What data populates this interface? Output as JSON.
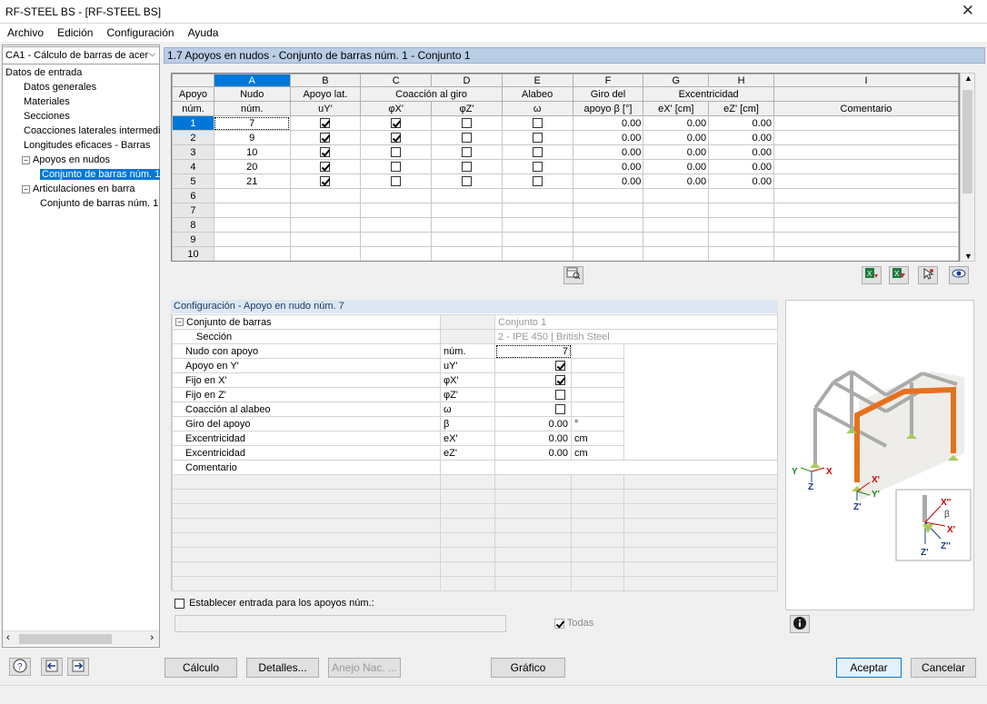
{
  "window": {
    "title": "RF-STEEL BS - [RF-STEEL BS]"
  },
  "menu": [
    "Archivo",
    "Edición",
    "Configuración",
    "Ayuda"
  ],
  "case_select": "CA1 - Cálculo de barras de acer",
  "tree": [
    {
      "label": "Datos de entrada",
      "level": 0
    },
    {
      "label": "Datos generales",
      "level": 1
    },
    {
      "label": "Materiales",
      "level": 1
    },
    {
      "label": "Secciones",
      "level": 1
    },
    {
      "label": "Coacciones laterales intermedia",
      "level": 1
    },
    {
      "label": "Longitudes eficaces - Barras",
      "level": 1
    },
    {
      "label": "Apoyos en nudos",
      "level": 1,
      "expander": "−"
    },
    {
      "label": "Conjunto de barras núm. 1",
      "level": 2,
      "selected": true
    },
    {
      "label": "Articulaciones en barra",
      "level": 1,
      "expander": "−"
    },
    {
      "label": "Conjunto de barras núm. 1",
      "level": 2
    }
  ],
  "panel_title": "1.7 Apoyos en nudos - Conjunto de barras núm. 1 - Conjunto 1",
  "grid": {
    "letters": [
      "A",
      "B",
      "C",
      "D",
      "E",
      "F",
      "G",
      "H",
      "I"
    ],
    "head1": {
      "row": "Apoyo",
      "a": "Nudo",
      "b": "Apoyo lat.",
      "cd": "Coacción al giro",
      "e": "Alabeo",
      "f": "Giro del",
      "gh": "Excentricidad",
      "i": ""
    },
    "head2": {
      "row": "núm.",
      "a": "núm.",
      "b": "uY'",
      "c": "φX'",
      "d": "φZ'",
      "e": "ω",
      "f": "apoyo β [°]",
      "g": "eX' [cm]",
      "h": "eZ' [cm]",
      "i": "Comentario"
    },
    "rows": [
      {
        "n": "1",
        "node": "7",
        "uy": true,
        "px": true,
        "pz": false,
        "w": false,
        "beta": "0.00",
        "ex": "0.00",
        "ez": "0.00"
      },
      {
        "n": "2",
        "node": "9",
        "uy": true,
        "px": true,
        "pz": false,
        "w": false,
        "beta": "0.00",
        "ex": "0.00",
        "ez": "0.00"
      },
      {
        "n": "3",
        "node": "10",
        "uy": true,
        "px": false,
        "pz": false,
        "w": false,
        "beta": "0.00",
        "ex": "0.00",
        "ez": "0.00"
      },
      {
        "n": "4",
        "node": "20",
        "uy": true,
        "px": false,
        "pz": false,
        "w": false,
        "beta": "0.00",
        "ex": "0.00",
        "ez": "0.00"
      },
      {
        "n": "5",
        "node": "21",
        "uy": true,
        "px": false,
        "pz": false,
        "w": false,
        "beta": "0.00",
        "ex": "0.00",
        "ez": "0.00"
      },
      {
        "n": "6"
      },
      {
        "n": "7"
      },
      {
        "n": "8"
      },
      {
        "n": "9"
      },
      {
        "n": "10"
      }
    ]
  },
  "config": {
    "title": "Configuración - Apoyo en nudo núm. 7",
    "group_label": "Conjunto de barras",
    "group_value": "Conjunto 1",
    "section_label": "Sección",
    "section_value": "2 - IPE 450 | British Steel",
    "rows": [
      {
        "label": "Nudo con apoyo",
        "sym": "núm.",
        "value": "7",
        "unit": ""
      },
      {
        "label": "Apoyo en Y'",
        "sym": "uY'",
        "check": true
      },
      {
        "label": "Fijo en X'",
        "sym": "φX'",
        "check": true
      },
      {
        "label": "Fijo en Z'",
        "sym": "φZ'",
        "check": false
      },
      {
        "label": "Coacción al alabeo",
        "sym": "ω",
        "check": false
      },
      {
        "label": "Giro del apoyo",
        "sym": "β",
        "value": "0.00",
        "unit": "°"
      },
      {
        "label": "Excentricidad",
        "sym": "eX'",
        "value": "0.00",
        "unit": "cm"
      },
      {
        "label": "Excentricidad",
        "sym": "eZ'",
        "value": "0.00",
        "unit": "cm"
      },
      {
        "label": "Comentario",
        "sym": "",
        "value": "",
        "unit": ""
      }
    ],
    "apply_label": "Establecer entrada para los apoyos núm.:",
    "all_label": "Todas"
  },
  "preview_labels": {
    "y": "Y",
    "x": "X",
    "z": "Z",
    "xp": "X'",
    "yp": "Y'",
    "zp": "Z'",
    "xpp": "X''",
    "beta": "β",
    "zpp": "Z''",
    "xp2": "X'",
    "zp2": "Z'"
  },
  "buttons": {
    "calc": "Cálculo",
    "details": "Detalles...",
    "annex": "Anejo Nac. ...",
    "graphic": "Gráfico",
    "ok": "Aceptar",
    "cancel": "Cancelar"
  },
  "colors": {
    "accent": "#0078d7",
    "header": "#b9cde5",
    "structure_orange": "#e8711f"
  }
}
